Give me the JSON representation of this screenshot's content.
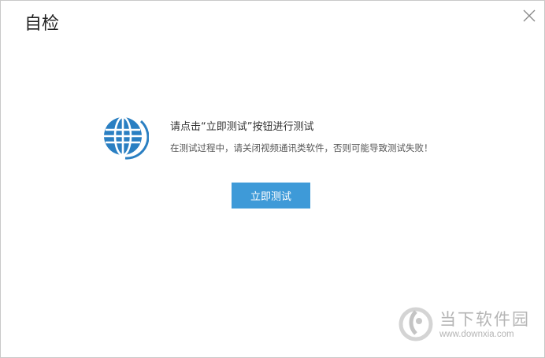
{
  "dialog": {
    "title": "自检",
    "close_icon": "close-icon"
  },
  "content": {
    "icon": "globe-icon",
    "icon_color": "#2a7fc2",
    "headline": "请点击“立即测试”按钮进行测试",
    "subtext": "在测试过程中，请关闭视频通讯类软件，否则可能导致测试失败！",
    "test_button_label": "立即测试",
    "button_color": "#3e9ad8"
  },
  "watermark": {
    "text": "当下软件园",
    "url": "www.downxia.com"
  }
}
